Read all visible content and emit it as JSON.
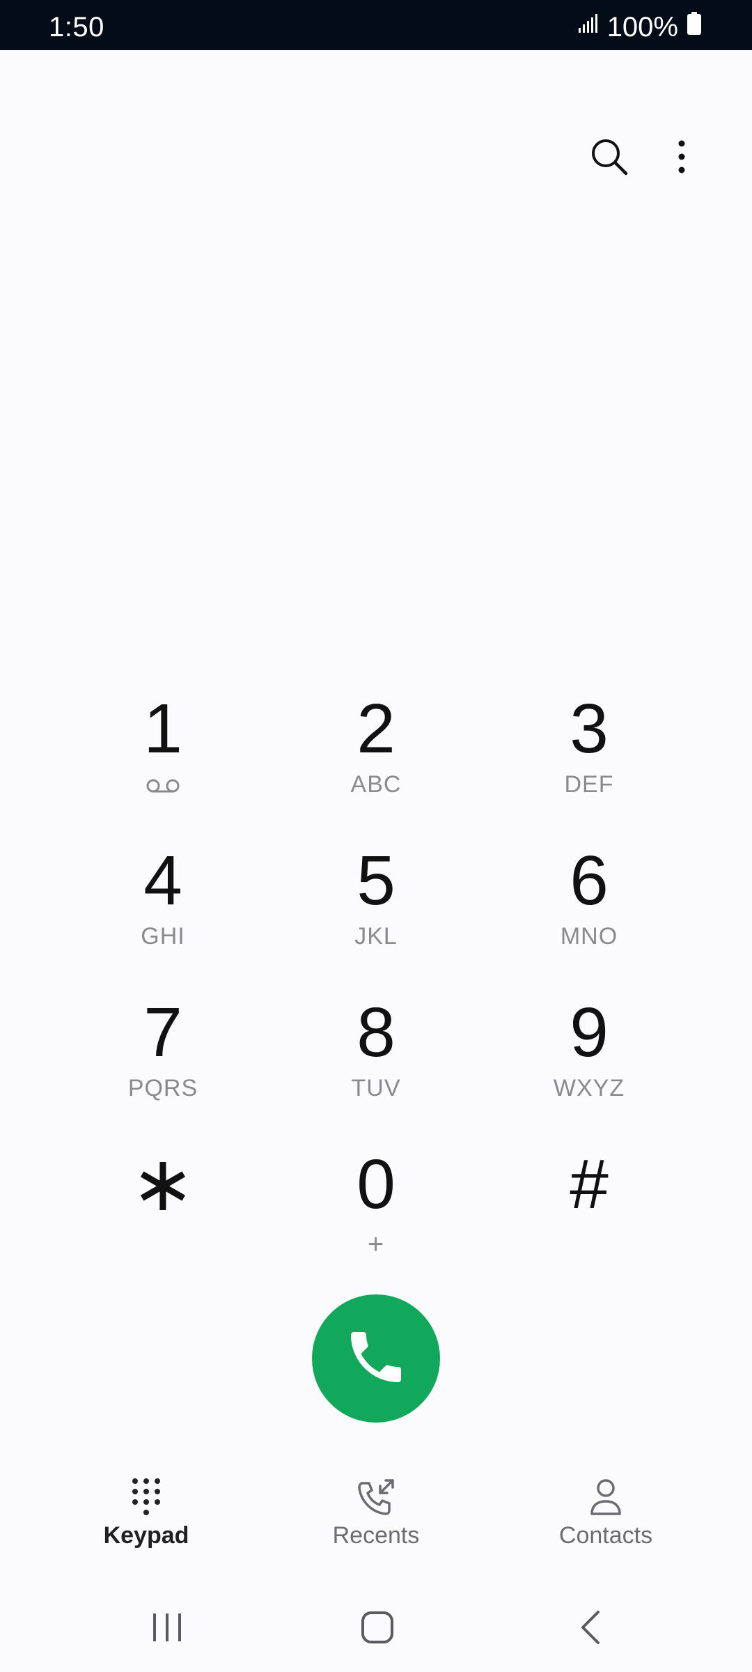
{
  "status_bar": {
    "time": "1:50",
    "battery": "100%",
    "icons": [
      "signal-icon",
      "battery-icon"
    ]
  },
  "toolbar": {
    "icons": [
      "search-icon",
      "more-options-icon"
    ]
  },
  "keypad": {
    "keys": [
      {
        "digit": "1",
        "letters": "",
        "sub_icon": "voicemail-icon"
      },
      {
        "digit": "2",
        "letters": "ABC"
      },
      {
        "digit": "3",
        "letters": "DEF"
      },
      {
        "digit": "4",
        "letters": "GHI"
      },
      {
        "digit": "5",
        "letters": "JKL"
      },
      {
        "digit": "6",
        "letters": "MNO"
      },
      {
        "digit": "7",
        "letters": "PQRS"
      },
      {
        "digit": "8",
        "letters": "TUV"
      },
      {
        "digit": "9",
        "letters": "WXYZ"
      },
      {
        "digit": "∗",
        "letters": ""
      },
      {
        "digit": "0",
        "letters": "+"
      },
      {
        "digit": "#",
        "letters": ""
      }
    ]
  },
  "call_button": {
    "icon": "phone-icon",
    "color": "#12a85b"
  },
  "bottom_nav": {
    "tabs": [
      {
        "label": "Keypad",
        "icon": "keypad-icon",
        "active": true
      },
      {
        "label": "Recents",
        "icon": "recents-icon",
        "active": false
      },
      {
        "label": "Contacts",
        "icon": "contacts-icon",
        "active": false
      }
    ]
  },
  "system_nav": {
    "icons": [
      "recent-apps-icon",
      "home-icon",
      "back-icon"
    ]
  }
}
